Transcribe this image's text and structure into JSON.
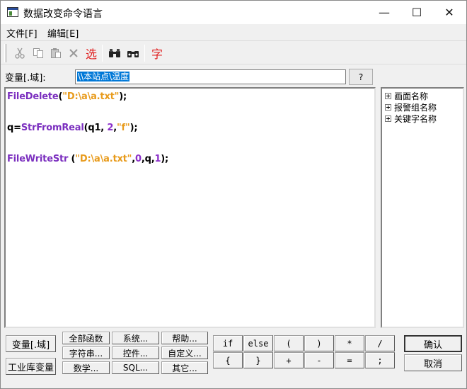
{
  "window": {
    "title": "数据改变命令语言",
    "minimize": "—",
    "maximize": "☐",
    "close": "✕"
  },
  "menu": [
    "文件[F]",
    "编辑[E]"
  ],
  "toolbar": {
    "icons": [
      "cut-icon",
      "copy-icon",
      "paste-icon",
      "delete-icon",
      "select-icon",
      "find-icon",
      "replace-icon",
      "font-icon"
    ],
    "select_label": "选",
    "font_label": "字"
  },
  "variable": {
    "label": "变量[.域]:",
    "value": "\\\\本站点\\温度",
    "help_label": "?"
  },
  "code": [
    [
      {
        "t": "FileDelete",
        "c": "fn"
      },
      {
        "t": "(",
        "c": "plain"
      },
      {
        "t": "\"D:\\a\\a.txt\"",
        "c": "str"
      },
      {
        "t": ");",
        "c": "plain"
      }
    ],
    [],
    [
      {
        "t": "q=",
        "c": "plain"
      },
      {
        "t": "StrFromReal",
        "c": "fn"
      },
      {
        "t": "(q1, ",
        "c": "plain"
      },
      {
        "t": "2",
        "c": "num"
      },
      {
        "t": ",",
        "c": "plain"
      },
      {
        "t": "\"f\"",
        "c": "str"
      },
      {
        "t": ");",
        "c": "plain"
      }
    ],
    [],
    [
      {
        "t": "FileWriteStr",
        "c": "fn"
      },
      {
        "t": " (",
        "c": "plain"
      },
      {
        "t": "\"D:\\a\\a.txt\"",
        "c": "str"
      },
      {
        "t": ",",
        "c": "plain"
      },
      {
        "t": "0",
        "c": "num"
      },
      {
        "t": ",q,",
        "c": "plain"
      },
      {
        "t": "1",
        "c": "num"
      },
      {
        "t": ");",
        "c": "plain"
      }
    ]
  ],
  "tree": [
    "画面名称",
    "报警组名称",
    "关键字名称"
  ],
  "bottom": {
    "side": [
      "变量[.域]",
      "工业库变量"
    ],
    "functions": [
      [
        "全部函数",
        "系统...",
        "帮助..."
      ],
      [
        "字符串...",
        "控件...",
        "自定义..."
      ],
      [
        "数学...",
        "SQL...",
        "其它..."
      ]
    ],
    "operators": [
      [
        "if",
        "else",
        "(",
        ")",
        "*",
        "/"
      ],
      [
        "{",
        "}",
        "+",
        "-",
        "=",
        ";"
      ]
    ],
    "confirm": "确认",
    "cancel": "取消"
  }
}
